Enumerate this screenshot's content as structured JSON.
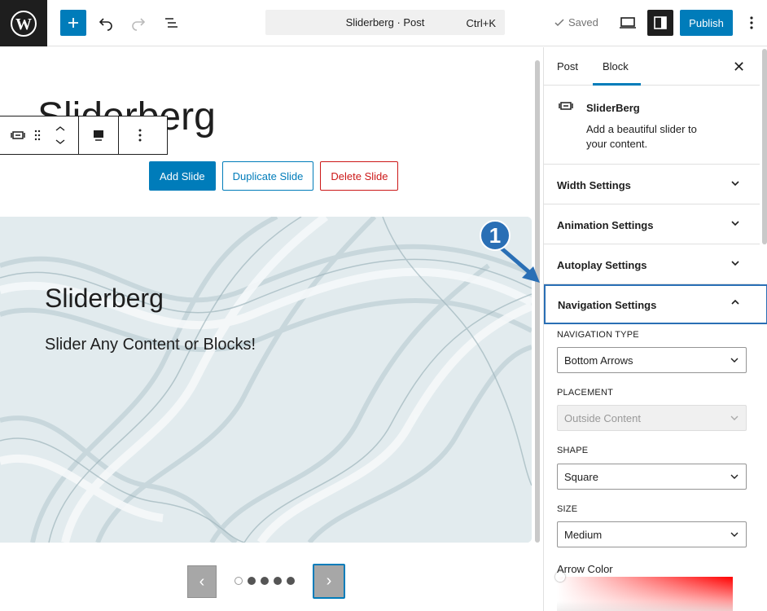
{
  "topbar": {
    "document_title": "Sliderberg · Post",
    "shortcut": "Ctrl+K",
    "saved_label": "Saved",
    "publish_label": "Publish",
    "icons": {
      "logo": "wordpress-logo",
      "add": "plus-icon",
      "undo": "undo-icon",
      "redo": "redo-icon",
      "list_view": "list-view-icon",
      "preview": "desktop-preview-icon",
      "settings": "sidebar-toggle-icon",
      "options": "more-vertical-icon"
    }
  },
  "editor": {
    "post_title": "Sliderberg",
    "slide_actions": {
      "add": "Add Slide",
      "duplicate": "Duplicate Slide",
      "delete": "Delete Slide"
    },
    "slide": {
      "heading": "Sliderberg",
      "subheading": "Slider Any Content or Blocks!"
    },
    "navigation": {
      "prev_arrow": "‹",
      "next_arrow": "›",
      "dot_count": 5,
      "active_dot": 0
    }
  },
  "annotation": {
    "marker_number": "1"
  },
  "sidebar": {
    "tabs": [
      {
        "label": "Post",
        "active": false
      },
      {
        "label": "Block",
        "active": true
      }
    ],
    "close_glyph": "✕",
    "block": {
      "name": "SliderBerg",
      "description": "Add a beautiful slider to your content."
    },
    "panels": [
      {
        "title": "Width Settings",
        "open": false
      },
      {
        "title": "Animation Settings",
        "open": false
      },
      {
        "title": "Autoplay Settings",
        "open": false
      },
      {
        "title": "Navigation Settings",
        "open": true
      }
    ],
    "navigation_settings": {
      "navigation_type": {
        "label": "NAVIGATION TYPE",
        "value": "Bottom Arrows"
      },
      "placement": {
        "label": "PLACEMENT",
        "value": "Outside Content",
        "disabled": true
      },
      "shape": {
        "label": "SHAPE",
        "value": "Square"
      },
      "size": {
        "label": "SIZE",
        "value": "Medium"
      },
      "arrow_color_label": "Arrow Color"
    }
  },
  "colors": {
    "accent": "#007cba",
    "danger": "#cc1818",
    "annotation": "#2a6fb5",
    "dark": "#1e1e1e"
  }
}
